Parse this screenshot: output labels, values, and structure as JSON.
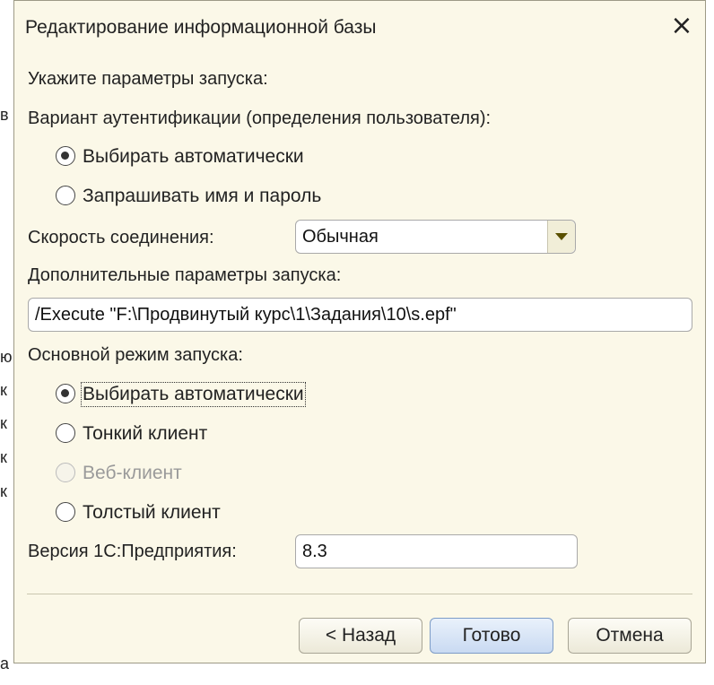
{
  "background_strip": [
    "в",
    "ю",
    "к",
    "к",
    "к",
    "к",
    "а"
  ],
  "dialog": {
    "title": "Редактирование информационной базы",
    "close_icon": "×"
  },
  "form": {
    "launch_params_heading": "Укажите параметры запуска:",
    "auth_label": "Вариант аутентификации (определения пользователя):",
    "auth_options": [
      {
        "label": "Выбирать автоматически",
        "checked": true
      },
      {
        "label": "Запрашивать имя и пароль",
        "checked": false
      }
    ],
    "speed_label": "Скорость соединения:",
    "speed_value": "Обычная",
    "extra_params_label": "Дополнительные параметры запуска:",
    "extra_params_value": "/Execute \"F:\\Продвинутый курс\\1\\Задания\\10\\s.epf\"",
    "mode_label": "Основной режим запуска:",
    "mode_options": [
      {
        "label": "Выбирать автоматически",
        "checked": true,
        "enabled": true
      },
      {
        "label": "Тонкий клиент",
        "checked": false,
        "enabled": true
      },
      {
        "label": "Веб-клиент",
        "checked": false,
        "enabled": false
      },
      {
        "label": "Толстый клиент",
        "checked": false,
        "enabled": true
      }
    ],
    "version_label": "Версия 1С:Предприятия:",
    "version_value": "8.3"
  },
  "buttons": {
    "back": "< Назад",
    "done": "Готово",
    "cancel": "Отмена"
  },
  "colors": {
    "dialog_bg": "#fbf8e8",
    "default_button": "#c9daf2",
    "combo_arrow": "#5a5000"
  }
}
